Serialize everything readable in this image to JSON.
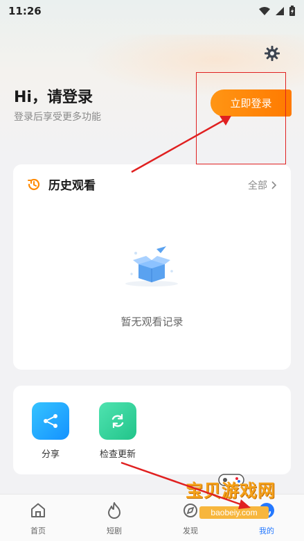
{
  "status_bar": {
    "time": "11:26"
  },
  "header": {
    "title": "Hi，请登录",
    "subtitle": "登录后享受更多功能",
    "login_button": "立即登录"
  },
  "history": {
    "title": "历史观看",
    "all_label": "全部",
    "empty_text": "暂无观看记录"
  },
  "tools": [
    {
      "label": "分享",
      "icon": "share-icon",
      "color": "#1fa6ff"
    },
    {
      "label": "检查更新",
      "icon": "refresh-icon",
      "color": "#2ed39a"
    }
  ],
  "tabbar": {
    "items": [
      {
        "label": "首页",
        "icon": "home-icon"
      },
      {
        "label": "短剧",
        "icon": "flame-icon"
      },
      {
        "label": "发现",
        "icon": "discover-icon"
      },
      {
        "label": "我的",
        "icon": "profile-icon",
        "active": true
      }
    ]
  },
  "watermark": {
    "title": "宝贝游戏网",
    "url": "baobeiy.com"
  },
  "colors": {
    "accent": "#ff8a00",
    "active_tab": "#2478ff",
    "annotation_red": "#e02020"
  }
}
